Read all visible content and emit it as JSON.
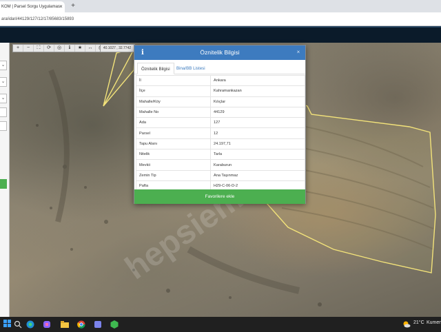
{
  "browser": {
    "tab_title": "KOM | Parsel Sorgu Uygulamas",
    "tab_close": "×",
    "new_tab": "+",
    "url": "ara/idari/44129/127/12/17/85683/15893"
  },
  "toolbar": {
    "buttons": [
      "+",
      "−",
      "⛶",
      "⟳",
      "◎",
      "ℹ",
      "★",
      "↔",
      "⎙"
    ],
    "coords": "40.1027 , 32.7742"
  },
  "side": {
    "items": [
      "⌄",
      "⌄",
      "⌄",
      "",
      ""
    ]
  },
  "watermark": "hepsiemlak",
  "dialog": {
    "info_glyph": "i",
    "title": "Öznitelik Bilgisi",
    "close": "×",
    "tabs": [
      {
        "label": "Öznitelik Bilgisi",
        "active": true
      },
      {
        "label": "Bina/BB Listesi",
        "active": false
      }
    ],
    "rows": [
      {
        "key": "İl",
        "value": "Ankara"
      },
      {
        "key": "İlçe",
        "value": "Kahramankazan"
      },
      {
        "key": "Mahalle/Köy",
        "value": "Kılıçlar"
      },
      {
        "key": "Mahalle No",
        "value": "44129"
      },
      {
        "key": "Ada",
        "value": "127"
      },
      {
        "key": "Parsel",
        "value": "12"
      },
      {
        "key": "Tapu Alanı",
        "value": "24.197,71"
      },
      {
        "key": "Nitelik",
        "value": "Tarla"
      },
      {
        "key": "Mevkii",
        "value": "Karaburun"
      },
      {
        "key": "Zemin Tip",
        "value": "Ana Taşınmaz"
      },
      {
        "key": "Pafta",
        "value": "H29-C-06-D-2"
      }
    ],
    "add_button": "Favorilere ekle"
  },
  "taskbar": {
    "weather": "21°C",
    "weather_desc": "Kumen"
  },
  "colors": {
    "dialog_header": "#3d7bbf",
    "favorite_button": "#4caf50",
    "parcel_outline": "#f3e37a"
  }
}
